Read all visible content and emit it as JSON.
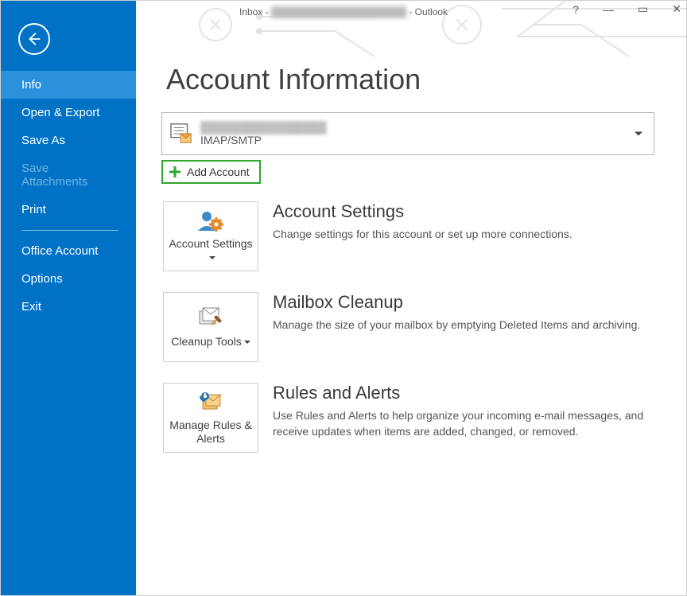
{
  "window": {
    "title_prefix": "Inbox - ",
    "title_blur": "████████████████████",
    "title_suffix": " - Outlook"
  },
  "sidebar": {
    "items": [
      {
        "label": "Info",
        "selected": true
      },
      {
        "label": "Open & Export"
      },
      {
        "label": "Save As"
      },
      {
        "label": "Save Attachments",
        "disabled": true
      },
      {
        "label": "Print"
      }
    ],
    "bottom_items": [
      {
        "label": "Office Account"
      },
      {
        "label": "Options"
      },
      {
        "label": "Exit"
      }
    ]
  },
  "page": {
    "title": "Account Information",
    "account_dropdown": {
      "account_name": "████████████████",
      "subtype": "IMAP/SMTP"
    },
    "add_account_label": "Add Account",
    "sections": [
      {
        "button_label": "Account Settings",
        "heading": "Account Settings",
        "description": "Change settings for this account or set up more connections.",
        "icon": "account-settings-icon"
      },
      {
        "button_label": "Cleanup Tools",
        "heading": "Mailbox Cleanup",
        "description": "Manage the size of your mailbox by emptying Deleted Items and archiving.",
        "icon": "cleanup-tools-icon"
      },
      {
        "button_label": "Manage Rules & Alerts",
        "heading": "Rules and Alerts",
        "description": "Use Rules and Alerts to help organize your incoming e-mail messages, and receive updates when items are added, changed, or removed.",
        "icon": "rules-alerts-icon"
      }
    ]
  }
}
